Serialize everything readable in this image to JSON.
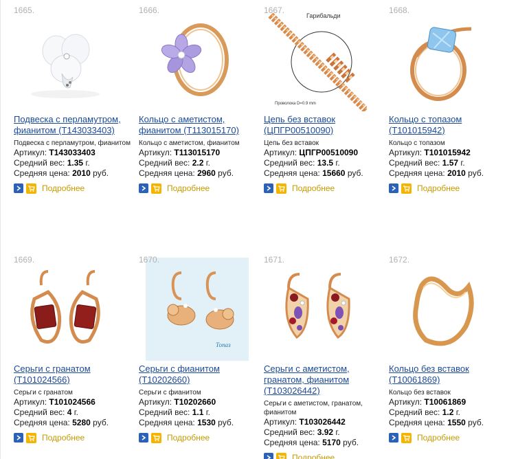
{
  "colors": {
    "link": "#1a4a99",
    "more_link": "#c79a00",
    "go_button": "#2b62b8",
    "cart_button": "#f4b400",
    "index_number": "#b0b0b0"
  },
  "products": [
    {
      "num": "1665.",
      "title": "Подвеска с перламутром, фианитом (Т143033403)",
      "desc": "Подвеска с перламутром, фианитом",
      "article_label": "Артикул:",
      "article": "Т143033403",
      "weight_label": "Средний вес:",
      "weight": "1.35",
      "weight_unit": "г.",
      "price_label": "Средняя цена:",
      "price": "2010",
      "price_unit": "руб.",
      "more": "Подробнее",
      "image": "pendant-pearl"
    },
    {
      "num": "1666.",
      "title": "Кольцо с аметистом, фианитом (Т113015170)",
      "desc": "Кольцо с аметистом, фианитом",
      "article_label": "Артикул:",
      "article": "Т113015170",
      "weight_label": "Средний вес:",
      "weight": "2.2",
      "weight_unit": "г.",
      "price_label": "Средняя цена:",
      "price": "2960",
      "price_unit": "руб.",
      "more": "Подробнее",
      "image": "ring-amethyst-flower"
    },
    {
      "num": "1667.",
      "title": "Цепь без вставок (ЦПГР00510090)",
      "desc": "Цепь без вставок",
      "article_label": "Артикул:",
      "article": "ЦПГР00510090",
      "weight_label": "Средний вес:",
      "weight": "13.5",
      "weight_unit": "г.",
      "price_label": "Средняя цена:",
      "price": "15660",
      "price_unit": "руб.",
      "more": "Подробнее",
      "image": "chain",
      "image_caption_top": "Гарибальди",
      "image_caption_bottom": "Проволока D=0.9 mm"
    },
    {
      "num": "1668.",
      "title": "Кольцо с топазом (Т101015942)",
      "desc": "Кольцо с топазом",
      "article_label": "Артикул:",
      "article": "Т101015942",
      "weight_label": "Средний вес:",
      "weight": "1.57",
      "weight_unit": "г.",
      "price_label": "Средняя цена:",
      "price": "2010",
      "price_unit": "руб.",
      "more": "Подробнее",
      "image": "ring-topaz"
    },
    {
      "num": "1669.",
      "title": "Серьги с гранатом (Т101024566)",
      "desc": "Серьги с гранатом",
      "article_label": "Артикул:",
      "article": "Т101024566",
      "weight_label": "Средний вес:",
      "weight": "4",
      "weight_unit": "г.",
      "price_label": "Средняя цена:",
      "price": "5280",
      "price_unit": "руб.",
      "more": "Подробнее",
      "image": "earrings-garnet"
    },
    {
      "num": "1670.",
      "title": "Серьги с фианитом (Т10202660)",
      "desc": "Серьги с фианитом",
      "article_label": "Артикул:",
      "article": "Т10202660",
      "weight_label": "Средний вес:",
      "weight": "1.1",
      "weight_unit": "г.",
      "price_label": "Средняя цена:",
      "price": "1530",
      "price_unit": "руб.",
      "more": "Подробнее",
      "image": "earrings-animal",
      "image_logo": "Топаз"
    },
    {
      "num": "1671.",
      "title": "Серьги с аметистом, гранатом, фианитом (Т103026442)",
      "desc": "Серьги с аметистом, гранатом, фианитом",
      "article_label": "Артикул:",
      "article": "Т103026442",
      "weight_label": "Средний вес:",
      "weight": "3.92",
      "weight_unit": "г.",
      "price_label": "Средняя цена:",
      "price": "5170",
      "price_unit": "руб.",
      "more": "Подробнее",
      "image": "earrings-multi"
    },
    {
      "num": "1672.",
      "title": "Кольцо без вставок (Т10061869)",
      "desc": "Кольцо без вставок",
      "article_label": "Артикул:",
      "article": "Т10061869",
      "weight_label": "Средний вес:",
      "weight": "1.2",
      "weight_unit": "г.",
      "price_label": "Средняя цена:",
      "price": "1550",
      "price_unit": "руб.",
      "more": "Подробнее",
      "image": "ring-wave"
    }
  ]
}
